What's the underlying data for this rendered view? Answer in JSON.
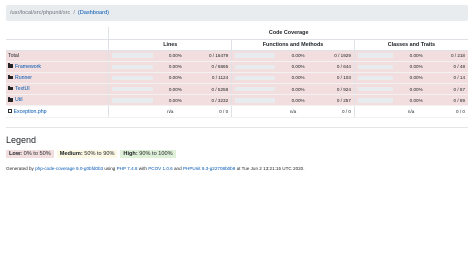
{
  "breadcrumb": {
    "path": "/usr/local/src/phpunit/src",
    "separator": "/",
    "dashboard_link": "(Dashboard)"
  },
  "table": {
    "header": {
      "title": "Code Coverage",
      "lines": "Lines",
      "functions": "Functions and Methods",
      "classes": "Classes and Traits"
    },
    "rows": [
      {
        "name": "Total",
        "kind": "total",
        "lines": {
          "pct": "0.00%",
          "count": "0 / 16479",
          "fill": 0
        },
        "functions": {
          "pct": "0.00%",
          "count": "0 / 1929",
          "fill": 0
        },
        "classes": {
          "pct": "0.00%",
          "count": "0 / 218",
          "fill": 0
        }
      },
      {
        "name": "Framework",
        "kind": "folder",
        "lines": {
          "pct": "0.00%",
          "count": "0 / 6865",
          "fill": 0
        },
        "functions": {
          "pct": "0.00%",
          "count": "0 / 644",
          "fill": 0
        },
        "classes": {
          "pct": "0.00%",
          "count": "0 / 48",
          "fill": 0
        }
      },
      {
        "name": "Runner",
        "kind": "folder",
        "lines": {
          "pct": "0.00%",
          "count": "0 / 1124",
          "fill": 0
        },
        "functions": {
          "pct": "0.00%",
          "count": "0 / 103",
          "fill": 0
        },
        "classes": {
          "pct": "0.00%",
          "count": "0 / 14",
          "fill": 0
        }
      },
      {
        "name": "TextUI",
        "kind": "folder",
        "lines": {
          "pct": "0.00%",
          "count": "0 / 5258",
          "fill": 0
        },
        "functions": {
          "pct": "0.00%",
          "count": "0 / 924",
          "fill": 0
        },
        "classes": {
          "pct": "0.00%",
          "count": "0 / 67",
          "fill": 0
        }
      },
      {
        "name": "Util",
        "kind": "folder",
        "lines": {
          "pct": "0.00%",
          "count": "0 / 3232",
          "fill": 0
        },
        "functions": {
          "pct": "0.00%",
          "count": "0 / 257",
          "fill": 0
        },
        "classes": {
          "pct": "0.00%",
          "count": "0 / 89",
          "fill": 0
        }
      },
      {
        "name": "Exception.php",
        "kind": "file",
        "lines": {
          "pct": "n/a",
          "count": "0 / 0"
        },
        "functions": {
          "pct": "n/a",
          "count": "0 / 0"
        },
        "classes": {
          "pct": "n/a",
          "count": "0 / 0"
        }
      }
    ]
  },
  "legend": {
    "title": "Legend",
    "low": {
      "label": "Low:",
      "range": "0% to 50%"
    },
    "medium": {
      "label": "Medium:",
      "range": "50% to 90%"
    },
    "high": {
      "label": "High:",
      "range": "90% to 100%"
    }
  },
  "footer": {
    "t1": "Generated by ",
    "l1": "php-code-coverage 9.0-g0bfd0b3",
    "t2": " using ",
    "l2": "PHP 7.4.6",
    "t3": " with ",
    "l3": "PCOV 1.0.6",
    "t4": " and ",
    "l4": "PHPUnit 9.3-g22708b0b9",
    "t5": " at Tue Jun 2 13:21:15 UTC 2020."
  },
  "colors": {
    "low": "#f2dede",
    "medium": "#fcf8e3",
    "high": "#dff0d8",
    "link": "#0056b3",
    "bar_danger": "#dc3545"
  }
}
